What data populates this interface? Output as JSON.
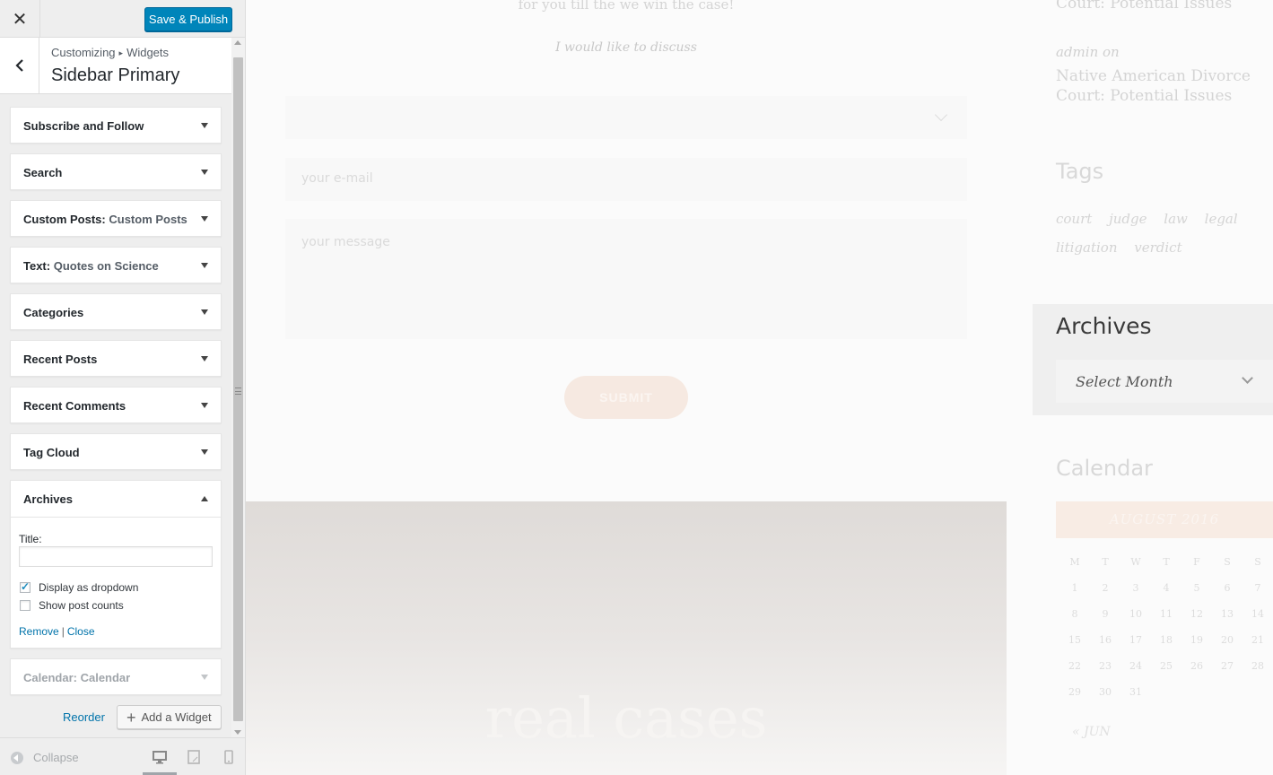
{
  "customizer": {
    "save_label": "Save & Publish",
    "breadcrumb": {
      "root": "Customizing",
      "separator": "▸",
      "current": "Widgets"
    },
    "section_title": "Sidebar Primary",
    "widgets": [
      {
        "title": "Subscribe and Follow",
        "sub": ""
      },
      {
        "title": "Search",
        "sub": ""
      },
      {
        "title": "Custom Posts",
        "sub": "Custom Posts"
      },
      {
        "title": "Text",
        "sub": "Quotes on Science"
      },
      {
        "title": "Categories",
        "sub": ""
      },
      {
        "title": "Recent Posts",
        "sub": ""
      },
      {
        "title": "Recent Comments",
        "sub": ""
      },
      {
        "title": "Tag Cloud",
        "sub": ""
      }
    ],
    "archives_widget": {
      "title": "Archives",
      "title_label": "Title:",
      "title_value": "",
      "dropdown_label": "Display as dropdown",
      "dropdown_checked": true,
      "post_counts_label": "Show post counts",
      "post_counts_checked": false,
      "remove_label": "Remove",
      "separator": "|",
      "close_label": "Close"
    },
    "calendar_widget": {
      "title": "Calendar",
      "sub": "Calendar"
    },
    "reorder_label": "Reorder",
    "add_widget_label": "Add a Widget",
    "collapse_label": "Collapse",
    "colors": {
      "primary": "#0085ba",
      "link": "#0073aa",
      "panel": "#eeeeee"
    }
  },
  "preview": {
    "tagline": "for you till the we win the case!",
    "discuss": "I would like to discuss",
    "email_placeholder": "your e-mail",
    "message_placeholder": "your message",
    "submit_label": "SUBMIT",
    "hero_text": "real cases",
    "sidebar": {
      "post_top": "Court: Potential Issues",
      "admin_line": "admin on",
      "post_title": "Native American Divorce Court: Potential Issues",
      "tags_heading": "Tags",
      "tags": [
        "court",
        "judge",
        "law",
        "legal",
        "litigation",
        "verdict"
      ],
      "archives_heading": "Archives",
      "archives_select": "Select Month",
      "calendar_heading": "Calendar",
      "calendar_month": "AUGUST 2016",
      "weekdays": [
        "M",
        "T",
        "W",
        "T",
        "F",
        "S",
        "S"
      ],
      "weeks": [
        [
          "1",
          "2",
          "3",
          "4",
          "5",
          "6",
          "7"
        ],
        [
          "8",
          "9",
          "10",
          "11",
          "12",
          "13",
          "14"
        ],
        [
          "15",
          "16",
          "17",
          "18",
          "19",
          "20",
          "21"
        ],
        [
          "22",
          "23",
          "24",
          "25",
          "26",
          "27",
          "28"
        ],
        [
          "29",
          "30",
          "31",
          "",
          "",
          "",
          ""
        ]
      ],
      "prev_month": "« JUN"
    }
  }
}
